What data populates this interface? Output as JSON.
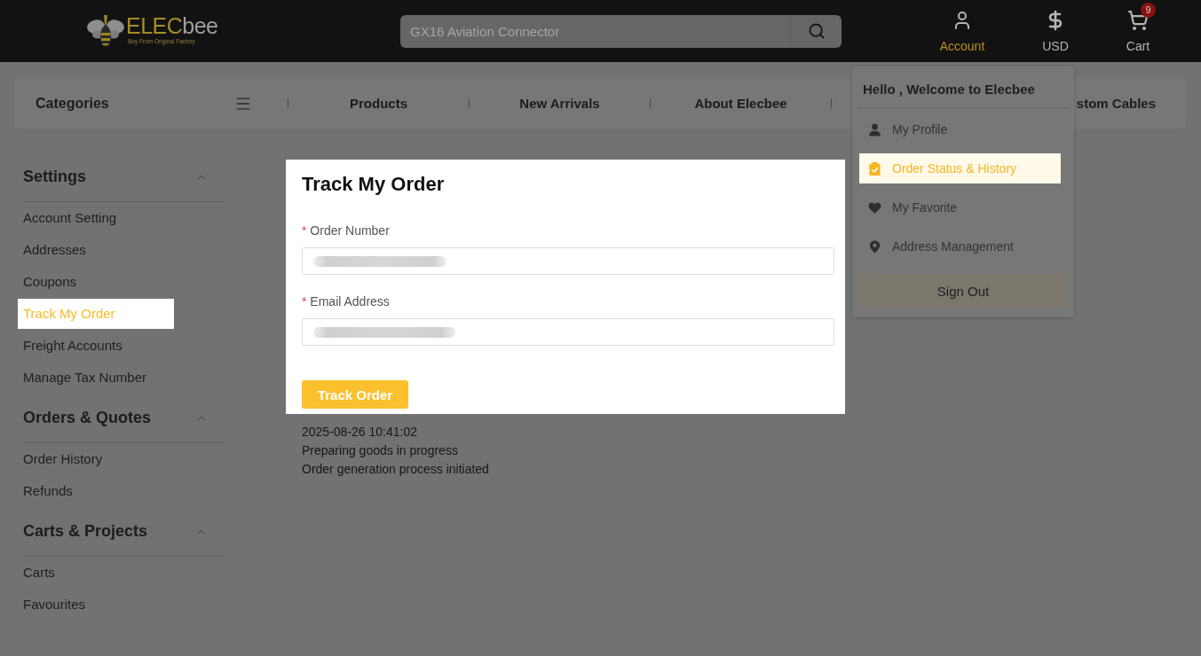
{
  "header": {
    "logo": {
      "brand_first": "ELEC",
      "brand_second": "bee",
      "tagline": "Buy From Original Factory"
    },
    "search": {
      "placeholder": "GX16 Aviation Connector"
    },
    "actions": [
      {
        "kind": "account",
        "label": "Account",
        "selected": true
      },
      {
        "kind": "currency",
        "label": "USD",
        "selected": false
      },
      {
        "kind": "cart",
        "label": "Cart",
        "badge": "9",
        "selected": false
      }
    ]
  },
  "nav": {
    "categories_label": "Categories",
    "links": [
      "Products",
      "New Arrivals",
      "About Elecbee"
    ],
    "partial_link": "stom Cables"
  },
  "account_menu": {
    "greeting": "Hello , Welcome to Elecbee",
    "items": [
      {
        "kind": "profile",
        "label": "My Profile",
        "selected": false
      },
      {
        "kind": "orders",
        "label": "Order Status & History",
        "selected": true
      },
      {
        "kind": "favorite",
        "label": "My Favorite",
        "selected": false
      },
      {
        "kind": "address",
        "label": "Address Management",
        "selected": false
      }
    ],
    "sign_out": "Sign Out"
  },
  "sidebar": {
    "groups": [
      {
        "title": "Settings",
        "expanded": true,
        "items": [
          {
            "label": "Account Setting",
            "selected": false
          },
          {
            "label": "Addresses",
            "selected": false
          },
          {
            "label": "Coupons",
            "selected": false
          },
          {
            "label": "Track My Order",
            "selected": true
          },
          {
            "label": "Freight Accounts",
            "selected": false
          },
          {
            "label": "Manage Tax Number",
            "selected": false
          }
        ]
      },
      {
        "title": "Orders & Quotes",
        "expanded": true,
        "items": [
          {
            "label": "Order History",
            "selected": false
          },
          {
            "label": "Refunds",
            "selected": false
          }
        ]
      },
      {
        "title": "Carts & Projects",
        "expanded": true,
        "items": [
          {
            "label": "Carts",
            "selected": false
          },
          {
            "label": "Favourites",
            "selected": false
          }
        ]
      }
    ]
  },
  "track_form": {
    "title": "Track My Order",
    "fields": [
      {
        "required_mark": "*",
        "label": "Order Number",
        "redacted": true
      },
      {
        "required_mark": "*",
        "label": "Email Address",
        "redacted": true
      }
    ],
    "submit": "Track Order"
  },
  "tracking_result": {
    "time": "2025-08-26 10:41:02",
    "events": [
      "Preparing goods in progress",
      "Order generation process initiated"
    ]
  }
}
